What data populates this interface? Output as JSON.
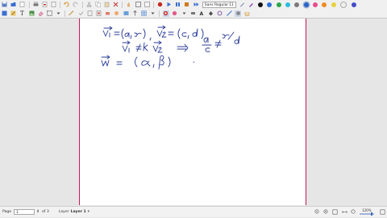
{
  "toolbar": {
    "font_name": "Sans Regular",
    "font_size": "11",
    "color_palette": [
      "#111111",
      "#2c6fd6",
      "#28a84a",
      "#27bde0",
      "#7a7a7a",
      "#2c63c5",
      "#e84a8a",
      "#f08a24",
      "#e6d23c",
      "#f0f0f0",
      "#444bc8"
    ],
    "selected_color_index": 5
  },
  "status": {
    "page_label": "Page",
    "page_value": "1",
    "page_count": "of 3",
    "layer_label": "Layer",
    "layer_value": "Layer 1",
    "zoom": "120%"
  },
  "ink": {
    "color": "#2b3c9a",
    "line1": "v₁ = (a, x) , v₂ = (c, d)",
    "line2": "v₁ ≠ k v₂ ⇒ a/c ≠ x/d",
    "line3": "w = (α, β)"
  }
}
